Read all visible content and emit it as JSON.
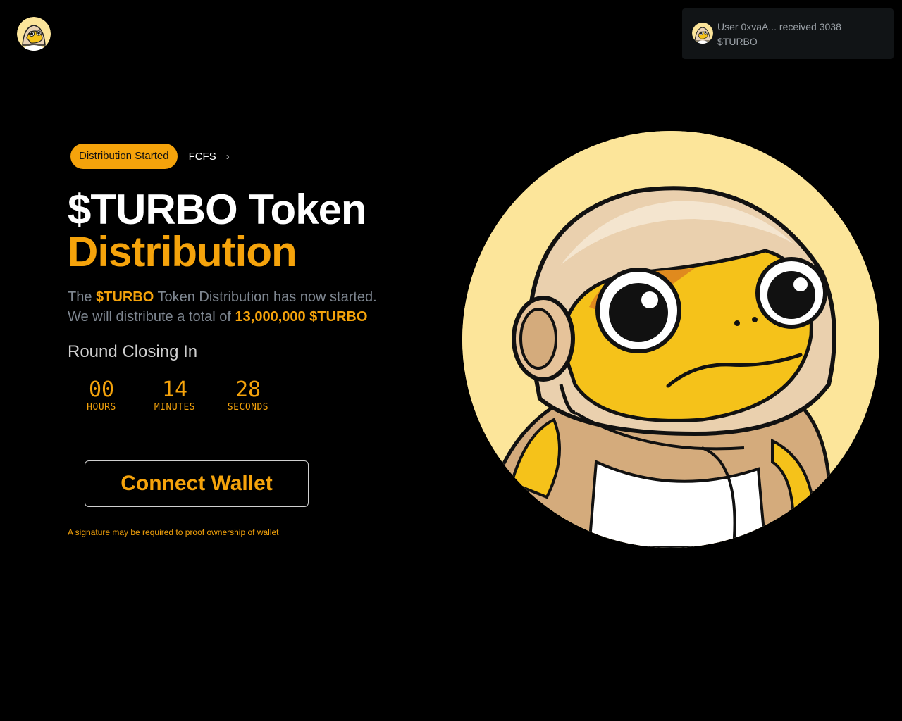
{
  "header": {
    "logo_icon": "turbo-toad-astronaut-logo"
  },
  "toast": {
    "avatar_icon": "turbo-toad-avatar",
    "message": "User 0xvaA... received 3038 $TURBO"
  },
  "hero": {
    "badge": "Distribution Started",
    "link_label": "FCFS",
    "link_icon": "chevron-right-icon",
    "title_line1": "$TURBO Token",
    "title_line2": "Distribution",
    "desc_part1": "The ",
    "desc_highlight1": "$TURBO",
    "desc_part2": " Token Distribution has now started.",
    "desc_part3": "We will distribute a total of ",
    "desc_highlight2": "13,000,000 $TURBO",
    "round_label": "Round Closing In",
    "countdown": [
      {
        "value": "00",
        "label": "HOURS"
      },
      {
        "value": "14",
        "label": "MINUTES"
      },
      {
        "value": "28",
        "label": "SECONDS"
      }
    ],
    "connect_button": "Connect Wallet",
    "note": "A signature may be required to proof ownership of wallet",
    "image_icon": "turbo-toad-astronaut-illustration"
  },
  "colors": {
    "accent": "#f5a30b",
    "background": "#000000",
    "muted_text": "#7f8791",
    "toast_bg": "#111416"
  }
}
